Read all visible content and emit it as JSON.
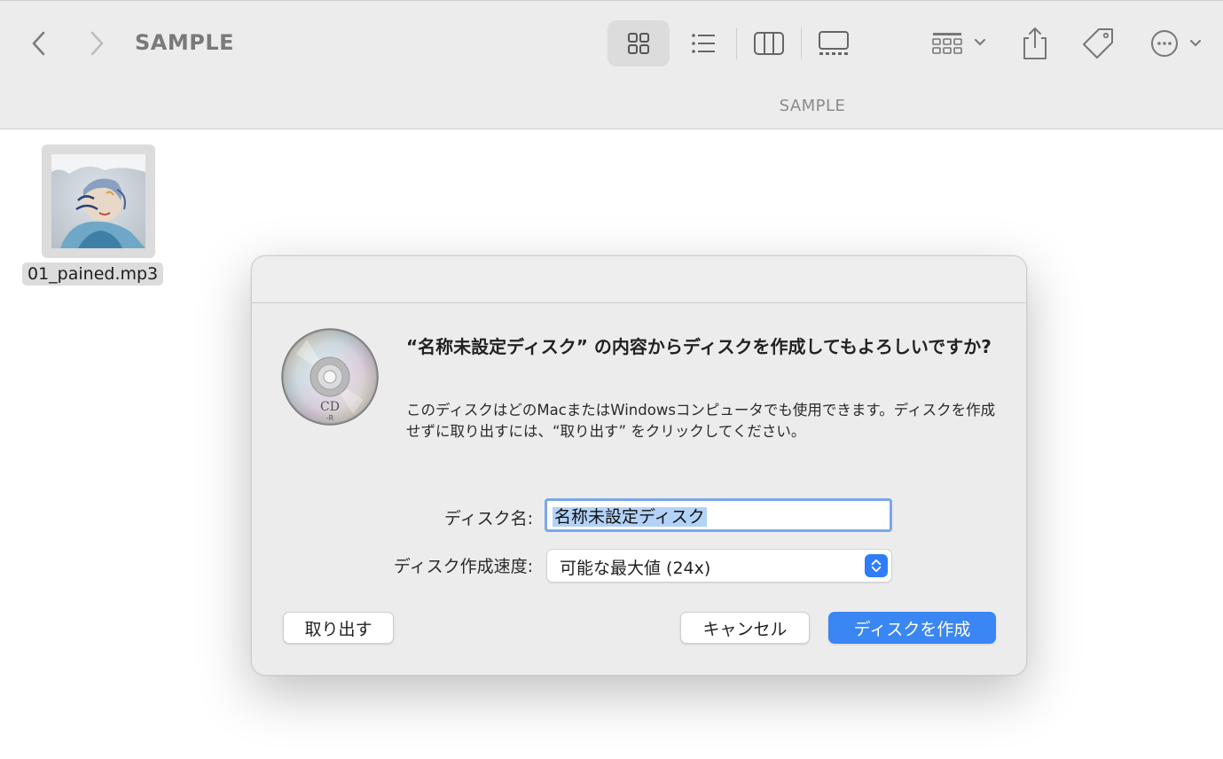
{
  "toolbar": {
    "window_title": "SAMPLE",
    "path_label": "SAMPLE",
    "icons": [
      "chevron-left-icon",
      "chevron-right-icon",
      "icon-view-icon",
      "list-view-icon",
      "column-view-icon",
      "gallery-view-icon",
      "group-icon",
      "share-icon",
      "tag-icon",
      "more-icon"
    ],
    "active_view": "icon-view"
  },
  "files": [
    {
      "name": "01_pained.mp3",
      "selected": true
    }
  ],
  "dialog": {
    "title": "“名称未設定ディスク” の内容からディスクを作成してもよろしいですか?",
    "message": "このディスクはどのMacまたはWindowsコンピュータでも使用できます。ディスクを作成せずに取り出すには、“取り出す” をクリックしてください。",
    "cd_icon_label": "CD",
    "cd_icon_sublabel": "-R",
    "disc_name_label": "ディスク名:",
    "disc_name_value": "名称未設定ディスク",
    "speed_label": "ディスク作成速度:",
    "speed_value": "可能な最大値 (24x)",
    "buttons": {
      "eject": "取り出す",
      "cancel": "キャンセル",
      "create": "ディスクを作成"
    },
    "accent_color": "#3a86f2"
  }
}
